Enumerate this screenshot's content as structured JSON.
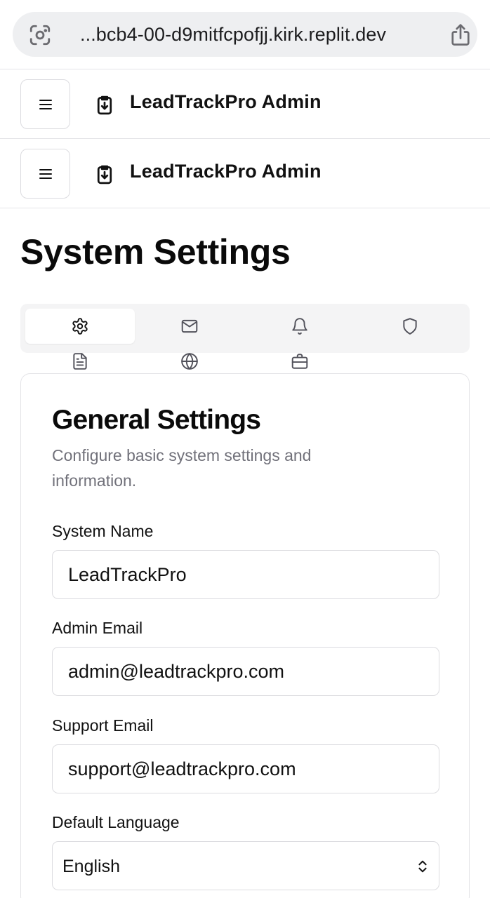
{
  "browser": {
    "url": "...bcb4-00-d9mitfcpofjj.kirk.replit.dev",
    "lens_icon": "camera-lens-icon",
    "share_icon": "share-icon"
  },
  "header": {
    "title": "LeadTrackPro Admin",
    "menu_icon": "hamburger-menu-icon",
    "brand_icon": "clipboard-download-icon"
  },
  "page": {
    "title": "System Settings"
  },
  "tabs": [
    {
      "icon": "gear-icon",
      "active": true
    },
    {
      "icon": "mail-icon",
      "active": false
    },
    {
      "icon": "bell-icon",
      "active": false
    },
    {
      "icon": "shield-icon",
      "active": false
    },
    {
      "icon": "document-icon",
      "active": false
    },
    {
      "icon": "globe-icon",
      "active": false
    },
    {
      "icon": "briefcase-icon",
      "active": false
    }
  ],
  "general": {
    "title": "General Settings",
    "description": "Configure basic system settings and information.",
    "fields": {
      "system_name": {
        "label": "System Name",
        "value": "LeadTrackPro"
      },
      "admin_email": {
        "label": "Admin Email",
        "value": "admin@leadtrackpro.com"
      },
      "support_email": {
        "label": "Support Email",
        "value": "support@leadtrackpro.com"
      },
      "default_language": {
        "label": "Default Language",
        "value": "English"
      }
    }
  },
  "colors": {
    "muted_text": "#71717a",
    "border": "#e4e4e7",
    "tab_bg": "#f4f4f5",
    "urlbar_bg": "#eeeff1"
  }
}
